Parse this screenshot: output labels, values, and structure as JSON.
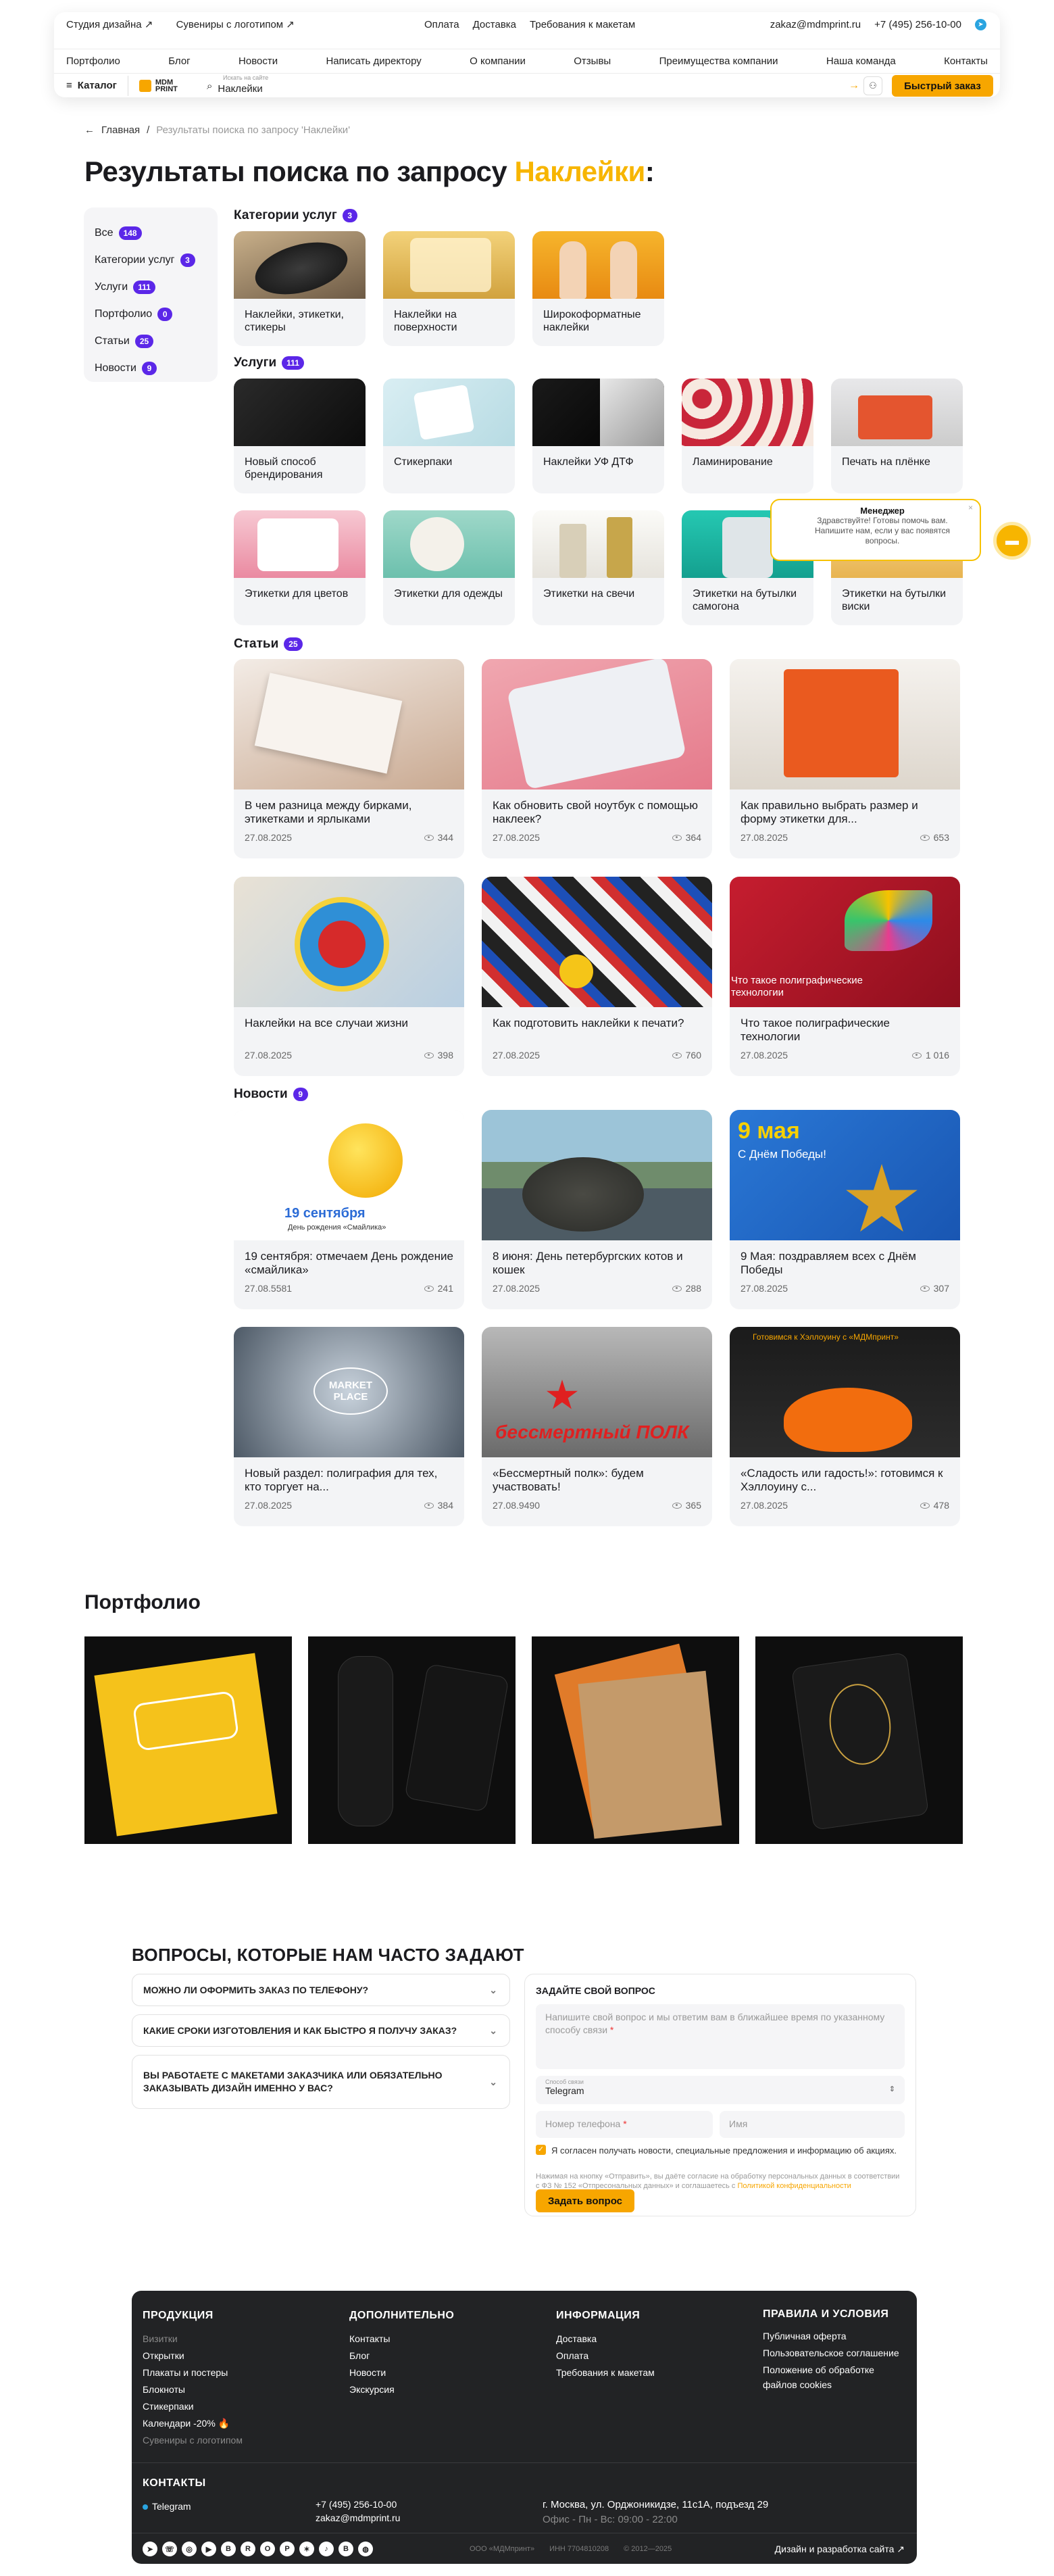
{
  "header": {
    "top_left": [
      "Студия дизайна ↗",
      "Сувениры с логотипом ↗"
    ],
    "top_mid": [
      "Оплата",
      "Доставка",
      "Требования к макетам"
    ],
    "email": "zakaz@mdmprint.ru",
    "phone": "+7 (495) 256-10-00",
    "nav": [
      "Портфолио",
      "Блог",
      "Новости",
      "Написать директору",
      "О компании",
      "Отзывы",
      "Преимущества компании",
      "Наша команда",
      "Контакты"
    ],
    "catalog": "Каталог",
    "logo": "MDM PRINT",
    "search_label": "Искать на сайте",
    "search_value": "Наклейки",
    "order_button": "Быстрый заказ"
  },
  "breadcrumb": {
    "home": "Главная",
    "current": "Результаты поиска по запросу 'Наклейки'"
  },
  "title": {
    "prefix": "Результаты поиска по запросу ",
    "query": "Наклейки",
    "suffix": ":"
  },
  "filters": [
    {
      "label": "Все",
      "count": "148"
    },
    {
      "label": "Категории услуг",
      "count": "3"
    },
    {
      "label": "Услуги",
      "count": "111"
    },
    {
      "label": "Портфолио",
      "count": "0"
    },
    {
      "label": "Статьи",
      "count": "25"
    },
    {
      "label": "Новости",
      "count": "9"
    }
  ],
  "sections": {
    "categories": {
      "title": "Категории услуг",
      "count": "3"
    },
    "services": {
      "title": "Услуги",
      "count": "111"
    },
    "articles": {
      "title": "Статьи",
      "count": "25"
    },
    "news": {
      "title": "Новости",
      "count": "9"
    }
  },
  "categories": [
    "Наклейки, этикетки, стикеры",
    "Наклейки на поверхности",
    "Широкоформатные наклейки"
  ],
  "services": [
    "Новый способ брендирования",
    "Стикерпаки",
    "Наклейки УФ ДТФ",
    "Ламинирование",
    "Печать на плёнке",
    "Этикетки для цветов",
    "Этикетки для одежды",
    "Этикетки на свечи",
    "Этикетки на бутылки самогона",
    "Этикетки на бутылки виски"
  ],
  "articles": [
    {
      "title": "В чем разница между бирками, этикетками и ярлыками",
      "date": "27.08.2025",
      "views": "344"
    },
    {
      "title": "Как обновить свой ноутбук с помощью наклеек?",
      "date": "27.08.2025",
      "views": "364"
    },
    {
      "title": "Как правильно выбрать размер и форму этикетки для...",
      "date": "27.08.2025",
      "views": "653"
    },
    {
      "title": "Наклейки на все случаи жизни",
      "date": "27.08.2025",
      "views": "398"
    },
    {
      "title": "Как подготовить наклейки к печати?",
      "date": "27.08.2025",
      "views": "760"
    },
    {
      "title": "Что такое полиграфические технологии",
      "date": "27.08.2025",
      "views": "1 016"
    }
  ],
  "article_img_caption": "Что такое полиграфические технологии",
  "news": [
    {
      "title": "19 сентября: отмечаем День рождение «смайлика»",
      "date": "27.08.5581",
      "views": "241"
    },
    {
      "title": "8 июня: День петербургских котов и кошек",
      "date": "27.08.2025",
      "views": "288"
    },
    {
      "title": "9 Мая: поздравляем всех с Днём Победы",
      "date": "27.08.2025",
      "views": "307"
    },
    {
      "title": "Новый раздел: полиграфия для тех, кто торгует на...",
      "date": "27.08.2025",
      "views": "384"
    },
    {
      "title": "«Бессмертный полк»: будем участвовать!",
      "date": "27.08.9490",
      "views": "365"
    },
    {
      "title": "«Сладость или гадость!»: готовимся к Хэллоуину с...",
      "date": "27.08.2025",
      "views": "478"
    }
  ],
  "news_img_text": {
    "smile_date": "19 сентября",
    "smile_sub": "День рождения «Смайлика»",
    "may": "9 мая",
    "may_sub": "С Днём Победы!",
    "market": "MARKET PLACE",
    "polk": "бессмертный ПОЛК",
    "halloween": "Готовимся к Хэллоуину с «МДМпринт»"
  },
  "portfolio": {
    "title": "Портфолио",
    "items": [
      "portfolio-1",
      "portfolio-2",
      "portfolio-3",
      "portfolio-4"
    ]
  },
  "faq": {
    "title": "ВОПРОСЫ, КОТОРЫЕ НАМ ЧАСТО ЗАДАЮТ",
    "items": [
      "МОЖНО ЛИ ОФОРМИТЬ ЗАКАЗ ПО ТЕЛЕФОНУ?",
      "КАКИЕ СРОКИ ИЗГОТОВЛЕНИЯ И КАК БЫСТРО Я ПОЛУЧУ ЗАКАЗ?",
      "ВЫ РАБОТАЕТЕ С МАКЕТАМИ ЗАКАЗЧИКА ИЛИ ОБЯЗАТЕЛЬНО ЗАКАЗЫВАТЬ ДИЗАЙН ИМЕННО У ВАС?"
    ]
  },
  "ask": {
    "title": "ЗАДАЙТЕ СВОЙ ВОПРОС",
    "question_placeholder": "Напишите свой вопрос и мы ответим вам в ближайшее время по указанному способу связи",
    "contact_label": "Способ связи",
    "contact_value": "Telegram",
    "phone_placeholder": "Номер телефона",
    "name_placeholder": "Имя",
    "consent": "Я согласен получать новости, специальные предложения и информацию об акциях.",
    "legal": "Нажимая на кнопку «Отправить», вы даёте согласие на обработку персональных данных в соответствии с ФЗ № 152 «Отпресональных данных» и соглашаетесь с",
    "policy_link": "Политикой конфиденциальности",
    "submit": "Задать вопрос"
  },
  "footer": {
    "products": {
      "title": "ПРОДУКЦИЯ",
      "items": [
        "Визитки",
        "Открытки",
        "Плакаты и постеры",
        "Блокноты",
        "Стикерпаки",
        "Календари -20% 🔥",
        "Сувениры с логотипом"
      ]
    },
    "extra": {
      "title": "ДОПОЛНИТЕЛЬНО",
      "items": [
        "Контакты",
        "Блог",
        "Новости",
        "Экскурсия"
      ]
    },
    "info": {
      "title": "ИНФОРМАЦИЯ",
      "items": [
        "Доставка",
        "Оплата",
        "Требования к макетам"
      ]
    },
    "rules": {
      "title": "ПРАВИЛА И УСЛОВИЯ",
      "items": [
        "Публичная оферта",
        "Пользовательское соглашение",
        "Положение об обработке файлов cookies"
      ]
    },
    "contacts_title": "КОНТАКТЫ",
    "telegram": "Telegram",
    "phone": "+7 (495) 256-10-00",
    "email": "zakaz@mdmprint.ru",
    "address": "г. Москва, ул. Орджоникидзе, 11с1А, подъезд 29",
    "hours": "Офис - Пн - Вс: 09:00 - 22:00",
    "company": "ООО «МДМпринт»",
    "inn": "ИНН 7704810208",
    "years": "© 2012—2025",
    "dev": "Дизайн и разработка сайта ↗"
  },
  "chat": {
    "title": "Менеджер",
    "text": "Здравствуйте! Готовы помочь вам. Напишите нам, если у вас появятся вопросы."
  },
  "colors": {
    "accent": "#f7a600",
    "badge": "#5b27e8",
    "footer": "#222325"
  }
}
